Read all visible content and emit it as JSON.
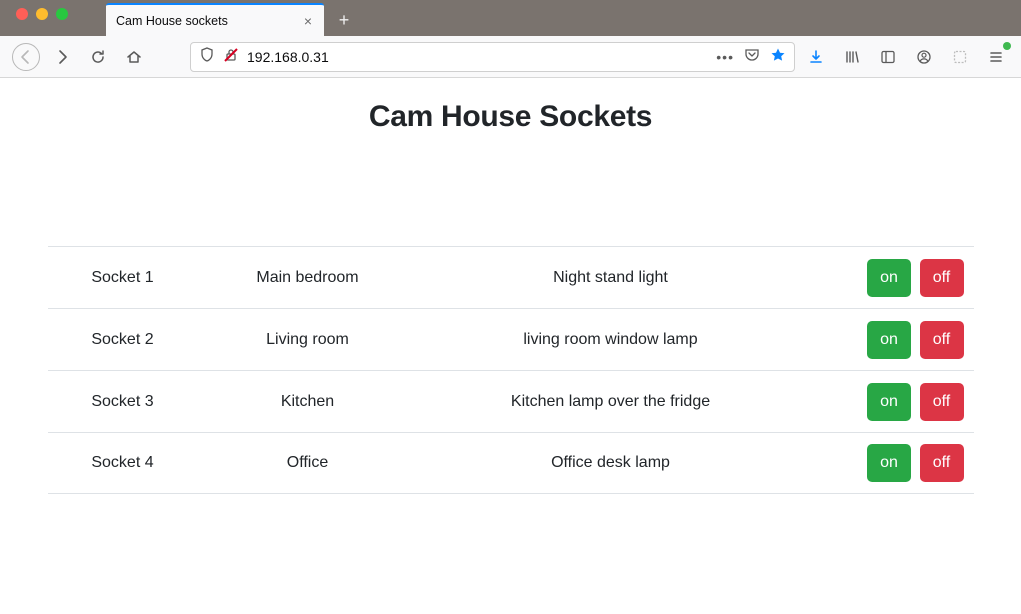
{
  "browser": {
    "tab_title": "Cam House sockets",
    "url": "192.168.0.31",
    "url_dots": "•••"
  },
  "page": {
    "title": "Cam House Sockets"
  },
  "buttons": {
    "on_label": "on",
    "off_label": "off"
  },
  "sockets": [
    {
      "id": "Socket 1",
      "location": "Main bedroom",
      "description": "Night stand light"
    },
    {
      "id": "Socket 2",
      "location": "Living room",
      "description": "living room window lamp"
    },
    {
      "id": "Socket 3",
      "location": "Kitchen",
      "description": "Kitchen lamp over the fridge"
    },
    {
      "id": "Socket 4",
      "location": "Office",
      "description": "Office desk lamp"
    }
  ]
}
